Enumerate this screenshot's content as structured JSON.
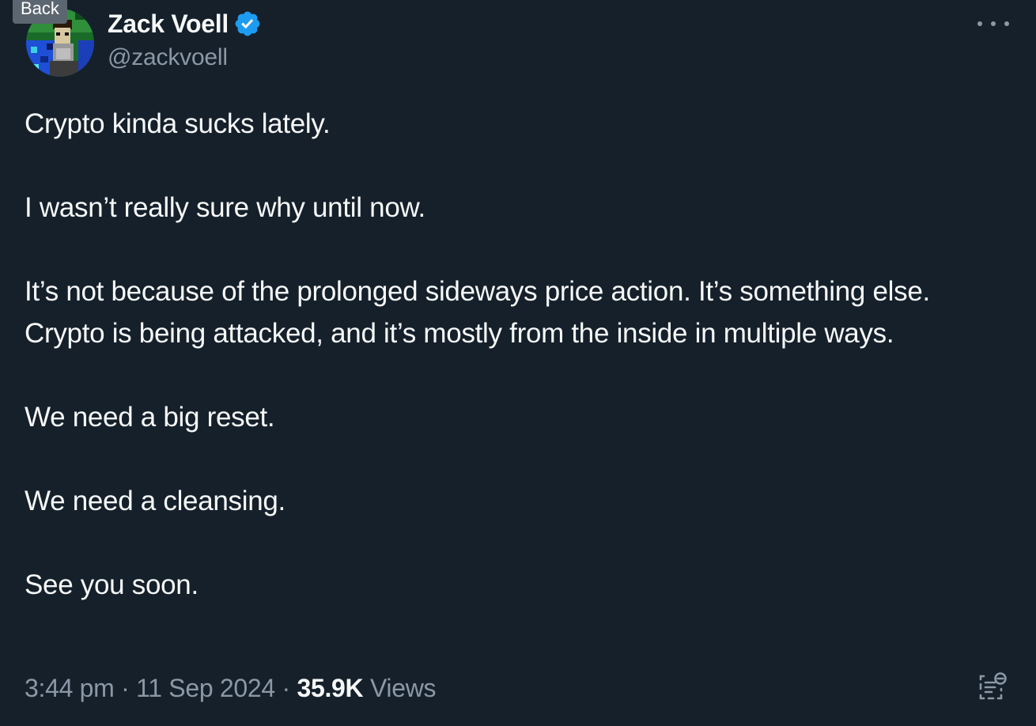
{
  "tooltip": {
    "label": "Back"
  },
  "author": {
    "display_name": "Zack Voell",
    "handle": "@zackvoell",
    "verified": true,
    "verified_color": "#1d9bf0"
  },
  "post": {
    "paragraphs": [
      "Crypto kinda sucks lately.",
      "I wasn’t really sure why until now.",
      "It’s not because of the prolonged sideways price action. It’s something else. Crypto is being attacked, and it’s mostly from the inside in multiple ways.",
      "We need a big reset.",
      "We need a cleansing.",
      "See you soon."
    ]
  },
  "meta": {
    "time": "3:44 pm",
    "date": "11 Sep 2024",
    "separator": "·",
    "views_count": "35.9K",
    "views_label": "Views"
  },
  "icons": {
    "more": "more-horizontal-icon",
    "verified": "verified-badge-icon",
    "translate": "translate-icon"
  },
  "colors": {
    "background": "#15202b",
    "text_primary": "#f7f9f9",
    "text_secondary": "#8b98a5"
  }
}
